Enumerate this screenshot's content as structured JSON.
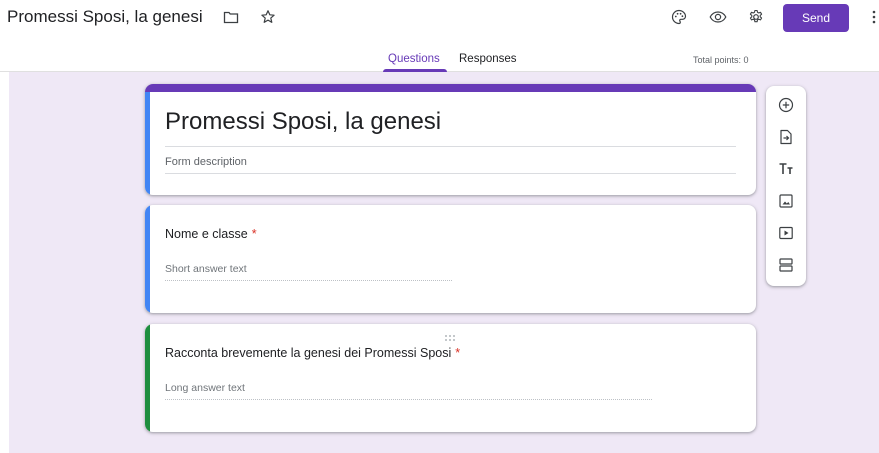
{
  "header": {
    "doc_title": "Promessi Sposi, la genesi",
    "send_label": "Send",
    "icons": [
      "folder-icon",
      "star-icon",
      "palette-icon",
      "preview-icon",
      "settings-icon",
      "more-vert-icon"
    ]
  },
  "tabs": {
    "items": [
      {
        "label": "Questions",
        "active": true
      },
      {
        "label": "Responses",
        "active": false
      }
    ],
    "total_points": "Total points: 0"
  },
  "form": {
    "title": "Promessi Sposi, la genesi",
    "description_placeholder": "Form description",
    "questions": [
      {
        "text": "Nome e classe",
        "required_mark": "*",
        "answer_hint": "Short answer text",
        "type": "short"
      },
      {
        "text": "Racconta brevemente la genesi dei Promessi Sposi",
        "required_mark": "*",
        "answer_hint": "Long answer text",
        "type": "long"
      }
    ]
  },
  "toolbar": {
    "tools": [
      "add-question-icon",
      "import-questions-icon",
      "add-title-icon",
      "add-image-icon",
      "add-video-icon",
      "add-section-icon"
    ]
  },
  "colors": {
    "accent": "#673ab7",
    "canvas_bg": "#efe8f6",
    "active_card_bar": "#1e8e3e",
    "card_bar": "#4285f4",
    "required": "#d93025"
  }
}
